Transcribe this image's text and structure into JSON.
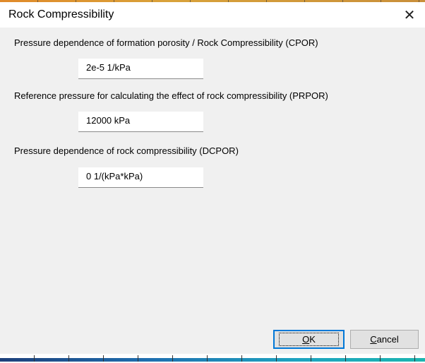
{
  "window": {
    "title": "Rock Compressibility",
    "close_glyph": "✕"
  },
  "fields": [
    {
      "label": "Pressure dependence of formation porosity / Rock Compressibility (CPOR)",
      "value": "2e-5  1/kPa"
    },
    {
      "label": "Reference pressure for calculating the effect of rock compressibility (PRPOR)",
      "value": "12000  kPa"
    },
    {
      "label": "Pressure dependence of rock compressibility (DCPOR)",
      "value": "0  1/(kPa*kPa)"
    }
  ],
  "buttons": {
    "ok_mnemonic": "O",
    "ok_rest": "K",
    "cancel_mnemonic": "C",
    "cancel_rest": "ancel"
  },
  "colors": {
    "focus_border": "#0078d7",
    "dialog_bg": "#f0f0f0"
  }
}
